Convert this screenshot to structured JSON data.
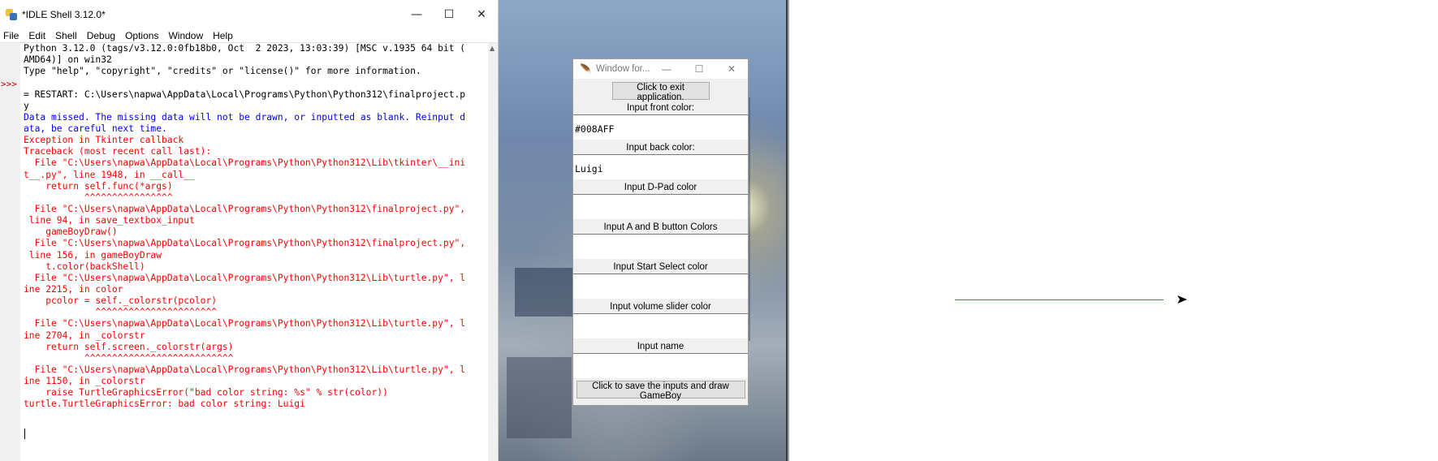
{
  "idle": {
    "title": "*IDLE Shell 3.12.0*",
    "controls": {
      "minimize": "—",
      "maximize": "☐",
      "close": "✕"
    },
    "menu": [
      "File",
      "Edit",
      "Shell",
      "Debug",
      "Options",
      "Window",
      "Help"
    ],
    "prompt": ">>>",
    "lines": [
      {
        "t": "Python 3.12.0 (tags/v3.12.0:0fb18b0, Oct  2 2023, 13:03:39) [MSC v.1935 64 bit (",
        "c": "out"
      },
      {
        "t": "AMD64)] on win32",
        "c": "out"
      },
      {
        "t": "Type \"help\", \"copyright\", \"credits\" or \"license()\" for more information.",
        "c": "out"
      },
      {
        "t": "",
        "c": "out"
      },
      {
        "t": "= RESTART: C:\\Users\\napwa\\AppData\\Local\\Programs\\Python\\Python312\\finalproject.p",
        "c": "out"
      },
      {
        "t": "y",
        "c": "out"
      },
      {
        "t": "Data missed. The missing data will not be drawn, or inputted as blank. Reinput d",
        "c": "blue"
      },
      {
        "t": "ata, be careful next time.",
        "c": "blue"
      },
      {
        "t": "Exception in Tkinter callback",
        "c": "err"
      },
      {
        "t": "Traceback (most recent call last):",
        "c": "err"
      },
      {
        "t": "  File \"C:\\Users\\napwa\\AppData\\Local\\Programs\\Python\\Python312\\Lib\\tkinter\\__ini",
        "c": "err"
      },
      {
        "t": "t__.py\", line 1948, in __call__",
        "c": "err"
      },
      {
        "t": "    return self.func(*args)",
        "c": "err"
      },
      {
        "t": "           ^^^^^^^^^^^^^^^^",
        "c": "err"
      },
      {
        "t": "  File \"C:\\Users\\napwa\\AppData\\Local\\Programs\\Python\\Python312\\finalproject.py\",",
        "c": "err"
      },
      {
        "t": " line 94, in save_textbox_input",
        "c": "err"
      },
      {
        "t": "    gameBoyDraw()",
        "c": "err"
      },
      {
        "t": "  File \"C:\\Users\\napwa\\AppData\\Local\\Programs\\Python\\Python312\\finalproject.py\",",
        "c": "err"
      },
      {
        "t": " line 156, in gameBoyDraw",
        "c": "err"
      },
      {
        "t": "    t.color(backShell)",
        "c": "err"
      },
      {
        "t": "  File \"C:\\Users\\napwa\\AppData\\Local\\Programs\\Python\\Python312\\Lib\\turtle.py\", l",
        "c": "err"
      },
      {
        "t": "ine 2215, in color",
        "c": "err"
      },
      {
        "t": "    pcolor = self._colorstr(pcolor)",
        "c": "err"
      },
      {
        "t": "             ^^^^^^^^^^^^^^^^^^^^^^",
        "c": "err"
      },
      {
        "t": "  File \"C:\\Users\\napwa\\AppData\\Local\\Programs\\Python\\Python312\\Lib\\turtle.py\", l",
        "c": "err"
      },
      {
        "t": "ine 2704, in _colorstr",
        "c": "err"
      },
      {
        "t": "    return self.screen._colorstr(args)",
        "c": "err"
      },
      {
        "t": "           ^^^^^^^^^^^^^^^^^^^^^^^^^^^",
        "c": "err"
      },
      {
        "t": "  File \"C:\\Users\\napwa\\AppData\\Local\\Programs\\Python\\Python312\\Lib\\turtle.py\", l",
        "c": "err"
      },
      {
        "t": "ine 1150, in _colorstr",
        "c": "err"
      },
      {
        "t": "    raise TurtleGraphicsError(\"bad color string: %s\" % str(color))",
        "c": "err"
      },
      {
        "t": "turtle.TurtleGraphicsError: bad color string: Luigi",
        "c": "err"
      }
    ]
  },
  "tk": {
    "title": "Window for...",
    "controls": {
      "minimize": "—",
      "maximize": "☐",
      "close": "✕"
    },
    "exit_button": "Click to exit application.",
    "fields": [
      {
        "label": "Input front color:",
        "value": "#008AFF"
      },
      {
        "label": "Input back color:",
        "value": "Luigi"
      },
      {
        "label": "Input D-Pad color",
        "value": ""
      },
      {
        "label": "Input A and B button Colors",
        "value": ""
      },
      {
        "label": "Input Start Select color",
        "value": ""
      },
      {
        "label": "Input volume slider color",
        "value": ""
      },
      {
        "label": "Input name",
        "value": ""
      }
    ],
    "save_button": "Click to save the inputs and draw GameBoy"
  },
  "turtle": {
    "line_color": "#2e6fd6"
  }
}
